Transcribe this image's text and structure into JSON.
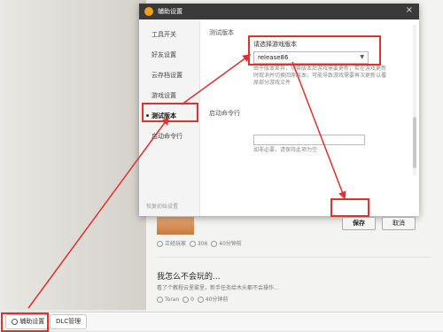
{
  "dialog": {
    "title": "辅助设置",
    "sidebar": [
      {
        "label": "工具开关"
      },
      {
        "label": "好友设置"
      },
      {
        "label": "云存档设置"
      },
      {
        "label": "游戏设置"
      },
      {
        "label": "测试版本"
      },
      {
        "label": "启动命令行"
      }
    ],
    "active_item": "测试版本",
    "footer_link": "恢复初始设置",
    "section_test": "测试版本",
    "select_label": "请选择游戏版本",
    "select_value": "release86",
    "version_note": "由于版本差异，切换版本后游戏需要更新；若在游戏更新时取消并切换回原版本，可能导致游戏需要再次更新以覆原部分游戏文件",
    "section_cmd": "启动命令行",
    "cmd_note": "如非必要，请保持此项为空",
    "save_label": "保存",
    "cancel_label": "取消"
  },
  "feed": {
    "card1_meta": {
      "author": "正经玩家",
      "views": "306",
      "time": "40分钟前"
    },
    "post_title": "我怎么不会玩的...",
    "post_desc": "看了个教程云里雾里，新手任务给木头都不会操作...",
    "card2_meta": {
      "author": "Toran",
      "views": "0",
      "time": "40分钟前"
    }
  },
  "bottom_bar": {
    "assist": "辅助设置",
    "dlc": "DLC管理"
  },
  "colors": {
    "annotation": "#e0302f",
    "titlebar": "#3a3a3a",
    "logo": "#f0a11c"
  }
}
